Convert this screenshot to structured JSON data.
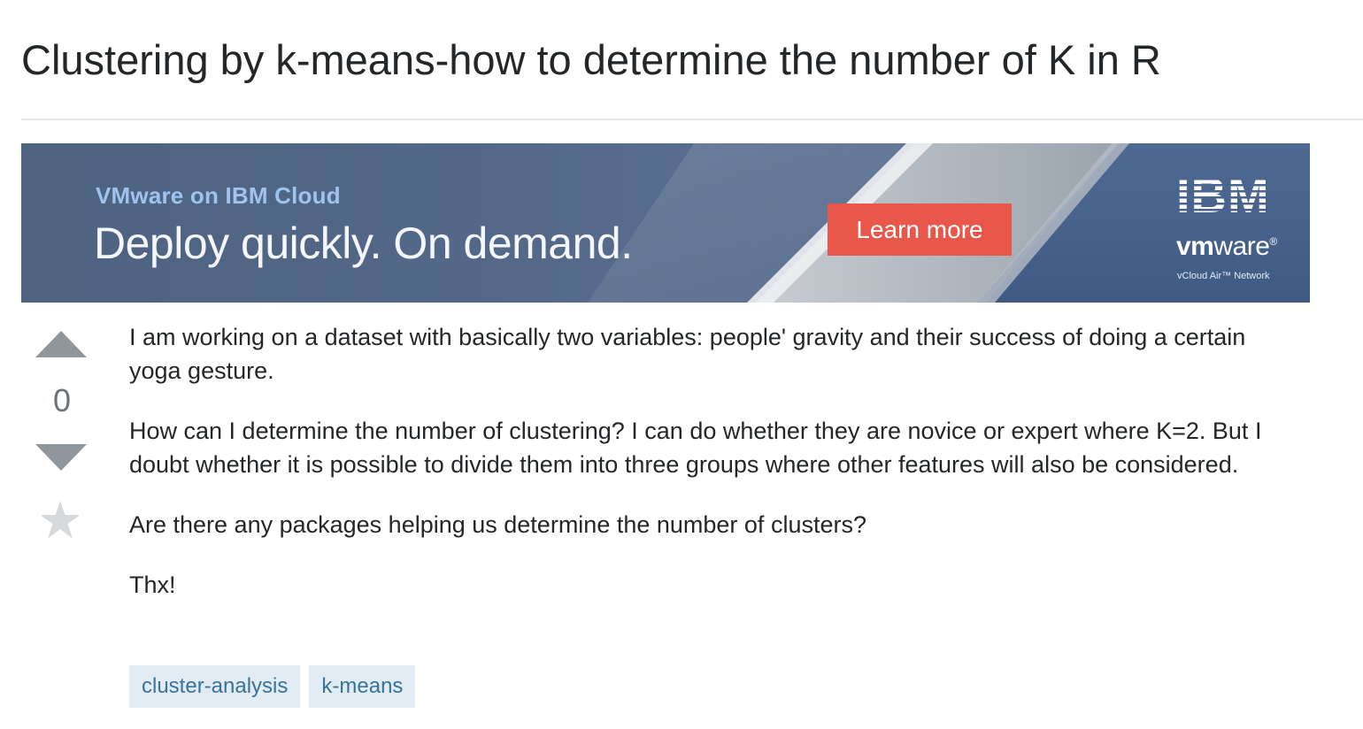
{
  "question": {
    "title": "Clustering by k-means-how to determine the number of K in R"
  },
  "ad": {
    "eyebrow": "VMware on IBM Cloud",
    "headline": "Deploy quickly. On demand.",
    "cta_label": "Learn more",
    "brand_ibm": "IBM",
    "brand_vmware_bold": "vm",
    "brand_vmware_rest": "ware",
    "brand_vmware_tm": "®",
    "brand_sub": "vCloud Air™ Network",
    "colors": {
      "cta": "#e8574a",
      "eyebrow": "#9fc3ef",
      "background": "#54698a"
    }
  },
  "votes": {
    "count": "0",
    "up_icon": "arrow-up-icon",
    "down_icon": "arrow-down-icon",
    "favorite_icon": "star-icon"
  },
  "post": {
    "paragraphs": [
      "I am working on a dataset with basically two variables: people' gravity and their success of doing a certain yoga gesture.",
      "How can I determine the number of clustering? I can do whether they are novice or expert where K=2. But I doubt whether it is possible to divide them into three groups where other features will also be considered.",
      "Are there any packages helping us determine the number of clusters?",
      "Thx!"
    ]
  },
  "tags": [
    {
      "label": "cluster-analysis"
    },
    {
      "label": "k-means"
    }
  ]
}
